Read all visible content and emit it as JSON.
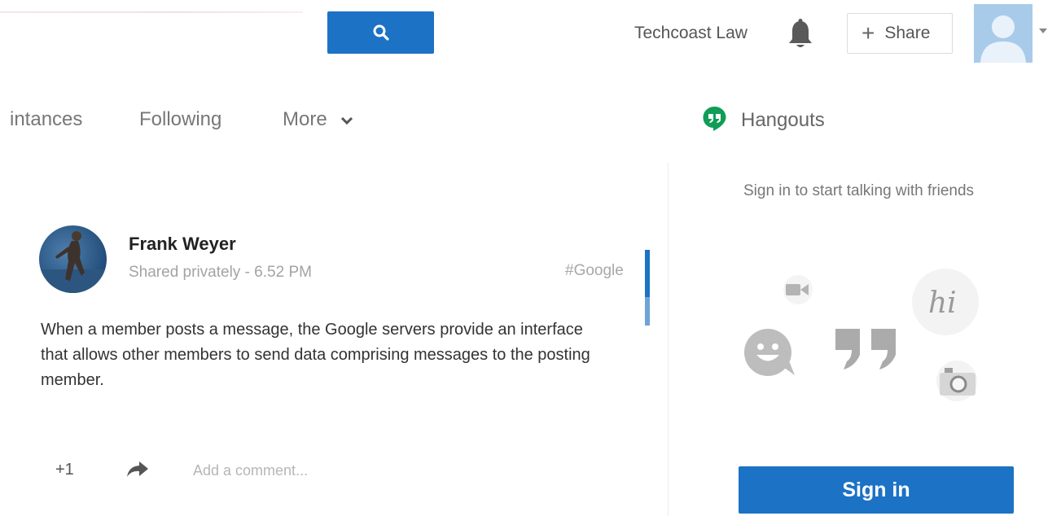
{
  "header": {
    "search_icon": "search-icon",
    "account_name": "Techcoast Law",
    "notifications_icon": "bell-icon",
    "share_plus": "+",
    "share_label": "Share"
  },
  "tabs": [
    {
      "label": "intances"
    },
    {
      "label": "Following"
    },
    {
      "label": "More"
    }
  ],
  "post": {
    "author": "Frank Weyer",
    "meta": "Shared privately  -  6.52 PM",
    "hashtag": "#Google",
    "body": "When a member posts a message, the Google servers provide an interface that allows other members to send data comprising messages to the posting member.",
    "plus_one": "+1",
    "comment_placeholder": "Add a comment..."
  },
  "hangouts": {
    "title": "Hangouts",
    "prompt": "Sign in to start talking with friends",
    "illustration_text": "hi",
    "signin_label": "Sign in"
  },
  "colors": {
    "accent": "#1c72c4",
    "hangouts_green": "#0f9d58"
  }
}
